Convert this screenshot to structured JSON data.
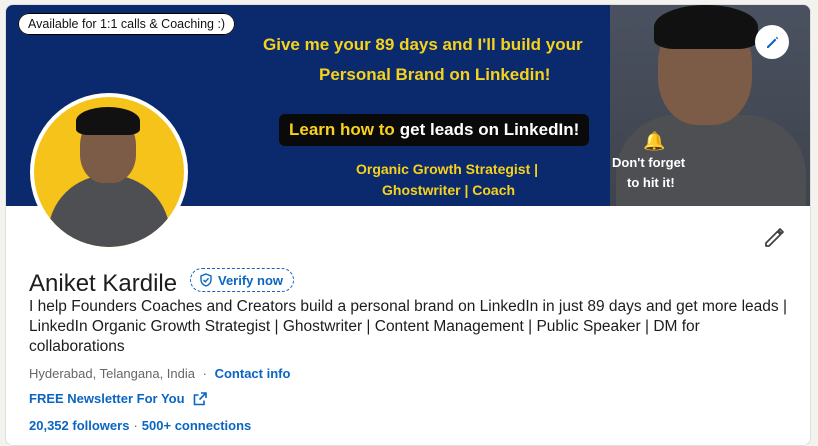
{
  "banner": {
    "pill": "Available for 1:1 calls & Coaching :)",
    "line1": "Give me your 89 days and I'll build your",
    "line2": "Personal Brand on Linkedin!",
    "learn_a": "Learn how to",
    "learn_b": "get leads on LinkedIn!",
    "role_line1": "Organic Growth Strategist |",
    "role_line2": "Ghostwriter | Coach",
    "forget_line1": "Don't forget",
    "forget_line2": "to hit it!",
    "edit_icon": "pencil-icon",
    "bell_icon": "bell-icon"
  },
  "profile": {
    "name": "Aniket Kardile",
    "verify_label": "Verify now",
    "headline": "I help Founders Coaches and Creators build a personal brand on LinkedIn in just 89 days and get more leads | LinkedIn Organic Growth Strategist | Ghostwriter | Content Management | Public Speaker | DM for collaborations",
    "location": "Hyderabad, Telangana, India",
    "dot": "·",
    "contact_label": "Contact info",
    "newsletter_label": "FREE Newsletter For You",
    "followers": "20,352 followers",
    "connections": "500+ connections"
  },
  "colors": {
    "accent": "#0a66c2",
    "banner_bg": "#0b2a6e",
    "banner_text": "#f7d21a"
  }
}
